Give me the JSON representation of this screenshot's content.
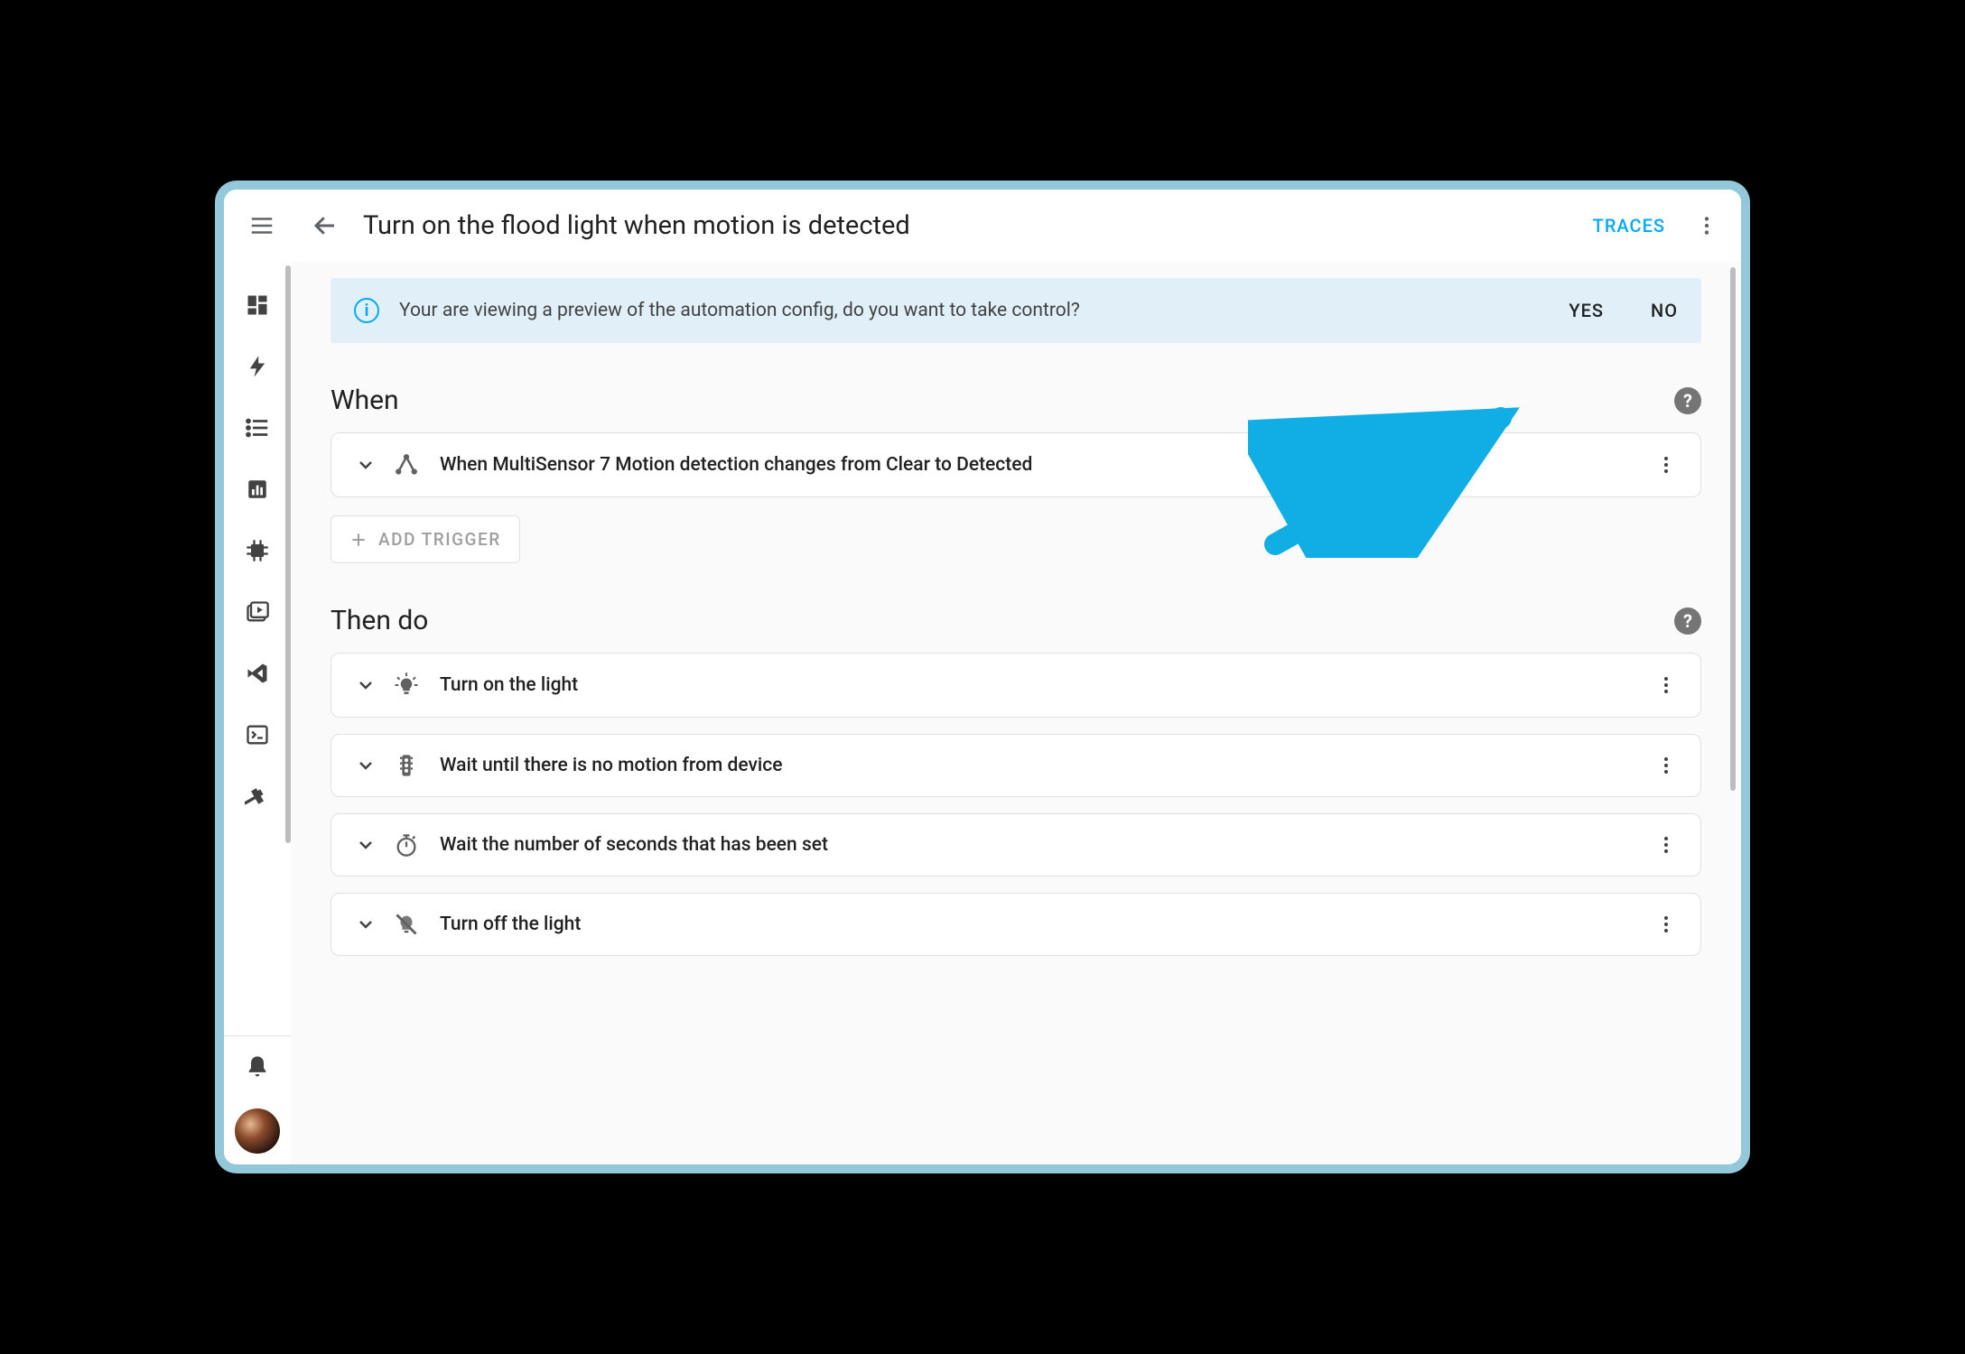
{
  "header": {
    "title": "Turn on the flood light when motion is detected",
    "traces_label": "TRACES"
  },
  "banner": {
    "text": "Your are viewing a preview of the automation config, do you want to take control?",
    "yes": "YES",
    "no": "NO"
  },
  "sections": {
    "when": {
      "title": "When",
      "items": [
        {
          "icon": "state-change",
          "label": "When MultiSensor 7 Motion detection changes from Clear to Detected"
        }
      ],
      "add_label": "ADD TRIGGER"
    },
    "then": {
      "title": "Then do",
      "items": [
        {
          "icon": "lightbulb",
          "label": "Turn on the light"
        },
        {
          "icon": "traffic-light",
          "label": "Wait until there is no motion from device"
        },
        {
          "icon": "stopwatch",
          "label": "Wait the number of seconds that has been set"
        },
        {
          "icon": "lightbulb-off",
          "label": "Turn off the light"
        }
      ]
    }
  }
}
